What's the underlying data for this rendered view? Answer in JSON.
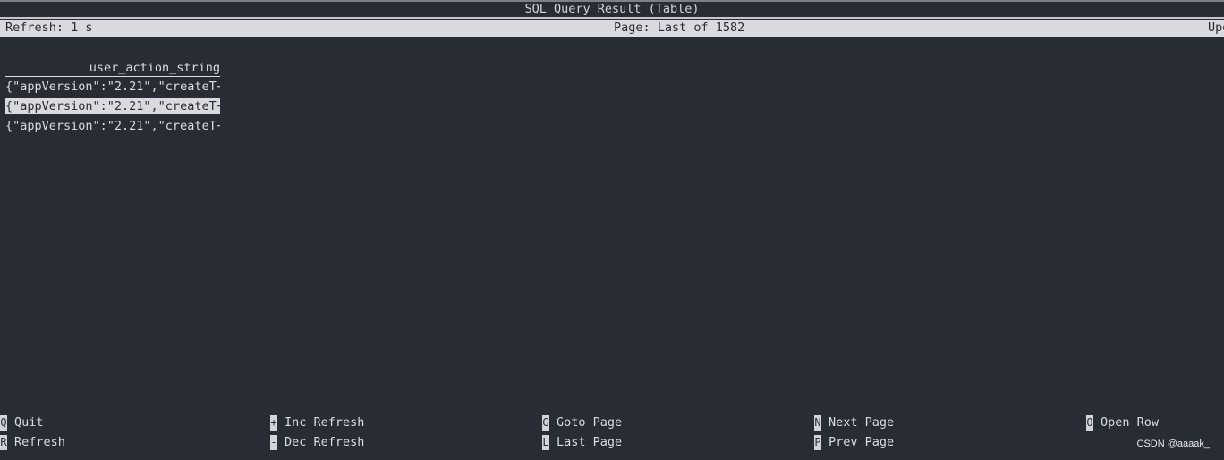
{
  "window": {
    "title": "SQL Query Result (Table)"
  },
  "status": {
    "refresh": "Refresh: 1 s",
    "page": "Page: Last of 1582",
    "right": "Upd"
  },
  "table": {
    "columns": [
      "user_action_string"
    ],
    "rows": [
      "{\"appVersion\":\"2.21\",\"createT~",
      "{\"appVersion\":\"2.21\",\"createT~",
      "{\"appVersion\":\"2.21\",\"createT~"
    ],
    "selected_row": 1
  },
  "shortcuts": [
    [
      {
        "key": "Q",
        "label": "Quit"
      },
      {
        "key": "R",
        "label": "Refresh"
      }
    ],
    [
      {
        "key": "+",
        "label": "Inc Refresh"
      },
      {
        "key": "-",
        "label": "Dec Refresh"
      }
    ],
    [
      {
        "key": "G",
        "label": "Goto Page"
      },
      {
        "key": "L",
        "label": "Last Page"
      }
    ],
    [
      {
        "key": "N",
        "label": "Next Page"
      },
      {
        "key": "P",
        "label": "Prev Page"
      }
    ],
    [
      {
        "key": "O",
        "label": "Open Row"
      }
    ]
  ],
  "watermark": "CSDN @aaaak_",
  "colors": {
    "background": "#282c34",
    "bar": "#d9dadd",
    "text": "#d8dce3"
  }
}
